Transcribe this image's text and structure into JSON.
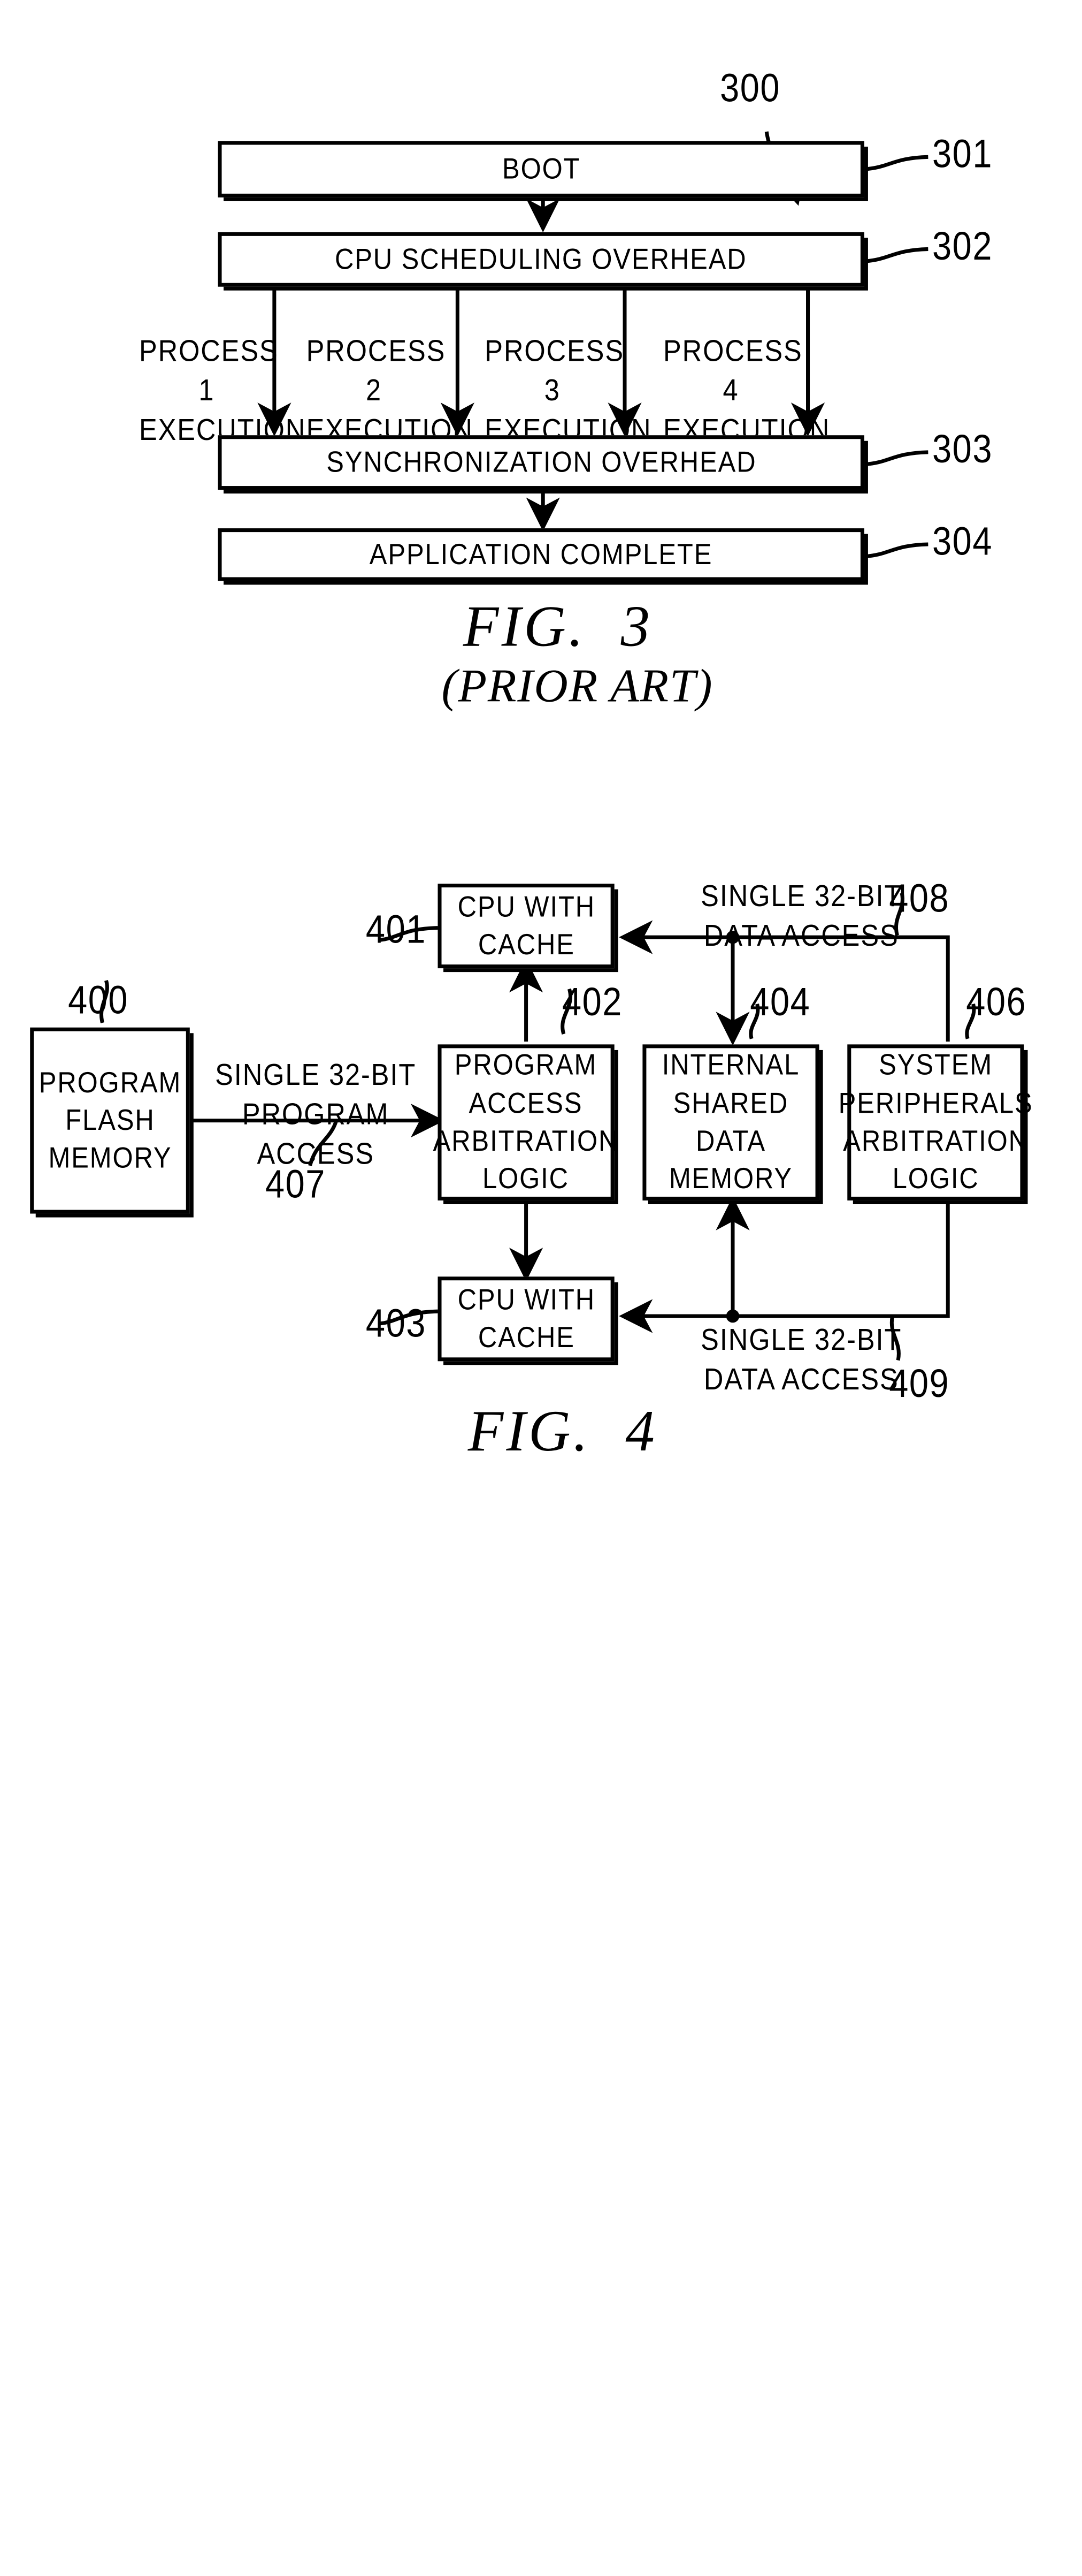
{
  "figures": [
    {
      "id": "fig3",
      "caption": "FIG.  3",
      "subcaption": "(PRIOR ART)",
      "diagram_ref": "300",
      "boxes": [
        {
          "label": "BOOT",
          "ref": "301"
        },
        {
          "label": "CPU SCHEDULING OVERHEAD",
          "ref": "302"
        },
        {
          "label": "SYNCHRONIZATION OVERHEAD",
          "ref": "303"
        },
        {
          "label": "APPLICATION COMPLETE",
          "ref": "304"
        }
      ],
      "process_labels": [
        "PROCESS 1\nEXECUTION",
        "PROCESS 2\nEXECUTION",
        "PROCESS 3\nEXECUTION",
        "PROCESS 4\nEXECUTION"
      ]
    },
    {
      "id": "fig4",
      "caption": "FIG.  4",
      "boxes": [
        {
          "label": "CPU WITH\nCACHE",
          "ref": "401"
        },
        {
          "label": "PROGRAM\nFLASH\nMEMORY",
          "ref": "400"
        },
        {
          "label": "PROGRAM\nACCESS\nARBITRATION\nLOGIC",
          "ref": "402"
        },
        {
          "label": "INTERNAL\nSHARED\nDATA MEMORY",
          "ref": "404"
        },
        {
          "label": "SYSTEM\nPERIPHERALS\nARBITRATION\nLOGIC",
          "ref": "406"
        },
        {
          "label": "CPU WITH\nCACHE",
          "ref": "403"
        }
      ],
      "annotations": [
        {
          "text": "SINGLE 32-BIT\nDATA ACCESS",
          "ref": "408"
        },
        {
          "text": "SINGLE 32-BIT\nPROGRAM ACCESS",
          "ref": "407"
        },
        {
          "text": "SINGLE 32-BIT\nDATA ACCESS",
          "ref": "409"
        }
      ]
    }
  ]
}
